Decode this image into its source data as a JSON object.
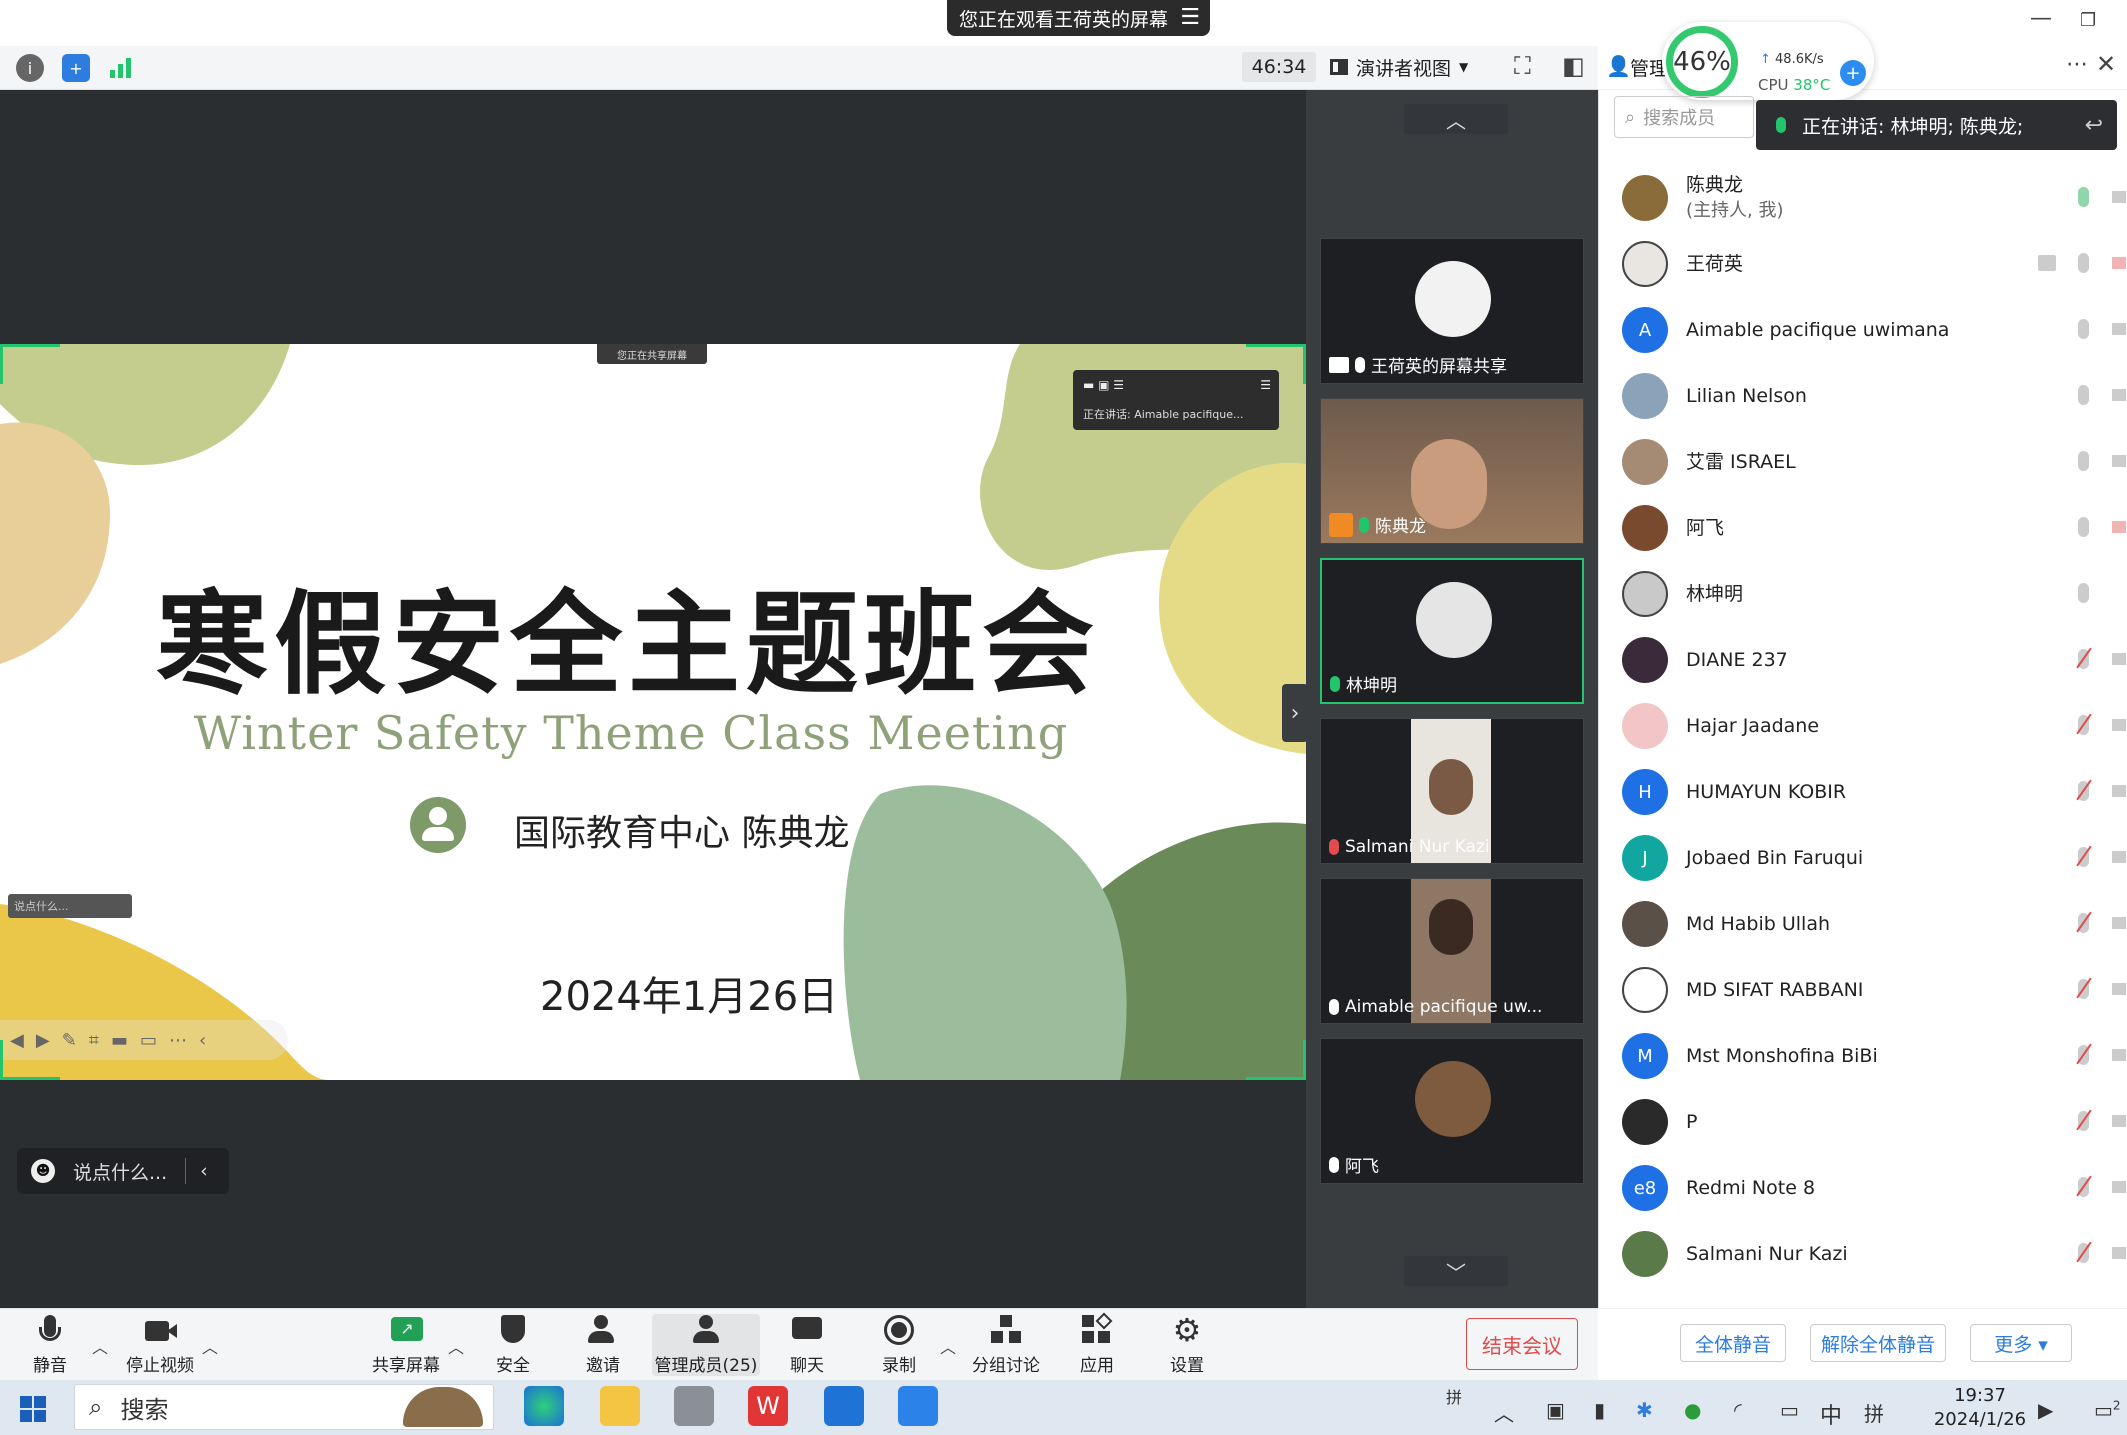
{
  "banner": {
    "text": "您正在观看王荷英的屏幕",
    "menu_icon": "list-icon"
  },
  "toolbar": {
    "timer": "46:34",
    "view_label": "演讲者视图",
    "manage_label": "管理"
  },
  "cpu_widget": {
    "percent": "46%",
    "net_speed": "48.6K/s",
    "cpu_label": "CPU",
    "cpu_temp": "38°C",
    "plus": "+"
  },
  "slide": {
    "share_tag": "您正在共享屏幕",
    "mini_speaking": "正在讲话:  Aimable pacifique...",
    "mini_chat": "说点什么...",
    "title": "寒假安全主题班会",
    "subtitle": "Winter Safety Theme Class Meeting",
    "author": "国际教育中心 陈典龙",
    "date": "2024年1月26日"
  },
  "chat_input": {
    "placeholder": "说点什么..."
  },
  "gallery": {
    "tiles": [
      {
        "name": "王荷英的屏幕共享",
        "mic": "on"
      },
      {
        "name": "陈典龙",
        "mic": "on-green"
      },
      {
        "name": "林坤明",
        "mic": "on-green",
        "active": true
      },
      {
        "name": "Salmani Nur Kazi",
        "mic": "muted"
      },
      {
        "name": "Aimable pacifique uw...",
        "mic": "on"
      },
      {
        "name": "阿飞",
        "mic": "on"
      }
    ]
  },
  "panel": {
    "search_placeholder": "搜索成员",
    "speaking": "正在讲话: 林坤明; 陈典龙;",
    "participants": [
      {
        "name": "陈典龙",
        "sub": "(主持人, 我)",
        "avatar_color": "#8a6b3a",
        "mic": "green",
        "cam": "on"
      },
      {
        "name": "王荷英",
        "avatar_color": "#e9e6e2",
        "mic": "on",
        "cam": "off",
        "share": true
      },
      {
        "name": "Aimable pacifique uwimana",
        "initial": "A",
        "avatar_color": "#1f6fe5",
        "mic": "on",
        "cam": "on"
      },
      {
        "name": "Lilian Nelson",
        "avatar_color": "#8aa3b8",
        "mic": "on",
        "cam": "on"
      },
      {
        "name": "艾雷  ISRAEL",
        "avatar_color": "#a58b73",
        "mic": "on",
        "cam": "on"
      },
      {
        "name": "阿飞",
        "avatar_color": "#7a4a2e",
        "mic": "on",
        "cam": "off"
      },
      {
        "name": "林坤明",
        "avatar_color": "#c9c9c9",
        "mic": "on",
        "cam": "none"
      },
      {
        "name": "DIANE 237",
        "avatar_color": "#3b2a3a",
        "mic": "muted",
        "cam": "on"
      },
      {
        "name": "Hajar Jaadane",
        "avatar_color": "#f2c6c6",
        "mic": "muted",
        "cam": "on"
      },
      {
        "name": "HUMAYUN KOBIR",
        "initial": "H",
        "avatar_color": "#1f6fe5",
        "mic": "muted",
        "cam": "on"
      },
      {
        "name": "Jobaed Bin Faruqui",
        "initial": "J",
        "avatar_color": "#12a6a0",
        "mic": "muted",
        "cam": "on"
      },
      {
        "name": "Md Habib Ullah",
        "avatar_color": "#5b5048",
        "mic": "muted",
        "cam": "on"
      },
      {
        "name": "MD SIFAT RABBANI",
        "avatar_color": "#ffffff",
        "mic": "muted",
        "cam": "on"
      },
      {
        "name": "Mst Monshofina BiBi",
        "initial": "M",
        "avatar_color": "#1f6fe5",
        "mic": "muted",
        "cam": "on"
      },
      {
        "name": "P",
        "avatar_color": "#2a2a2a",
        "mic": "muted",
        "cam": "on"
      },
      {
        "name": "Redmi Note 8",
        "initial": "e8",
        "avatar_color": "#1f6fe5",
        "mic": "muted",
        "cam": "on"
      },
      {
        "name": "Salmani Nur Kazi",
        "avatar_color": "#5a7a4a",
        "mic": "muted",
        "cam": "on"
      }
    ],
    "mute_all": "全体静音",
    "unmute_all": "解除全体静音",
    "more": "更多 ▾"
  },
  "bottombar": {
    "mute": "静音",
    "stop_video": "停止视频",
    "share": "共享屏幕",
    "security": "安全",
    "invite": "邀请",
    "manage": "管理成员(25)",
    "chat": "聊天",
    "record": "录制",
    "breakout": "分组讨论",
    "apps": "应用",
    "settings": "设置",
    "end": "结束会议"
  },
  "taskbar": {
    "search": "搜索",
    "time": "19:37",
    "date": "2024/1/26",
    "ime": "中",
    "ime2": "拼",
    "notif": "2"
  },
  "colors": {
    "accent_green": "#22c56b",
    "zoom_blue": "#2d7de0",
    "end_red": "#e14b4b"
  }
}
